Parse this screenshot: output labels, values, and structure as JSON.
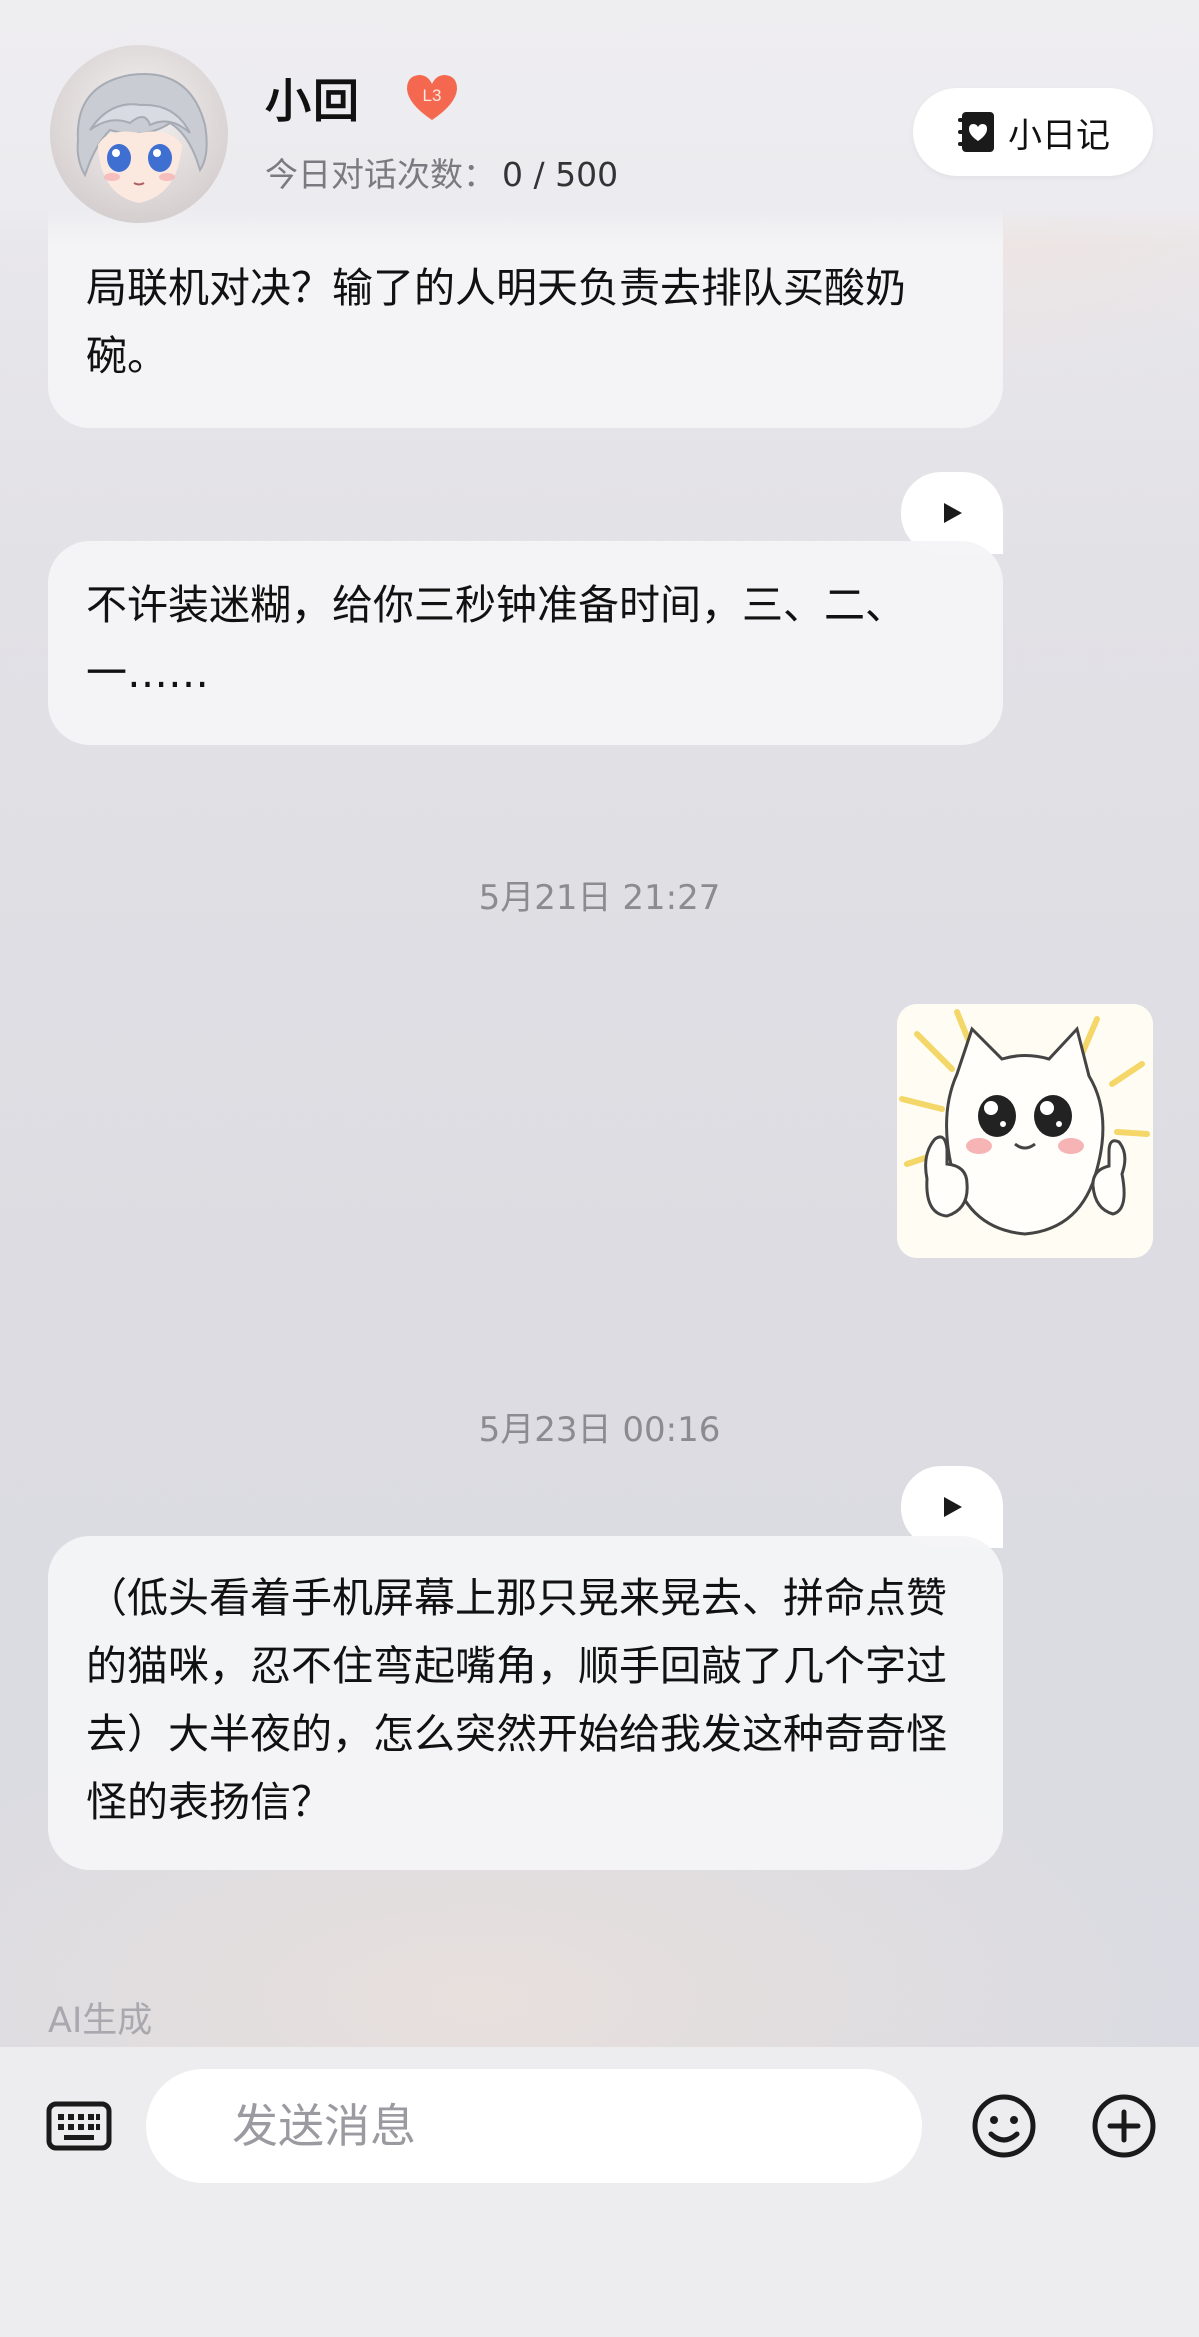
{
  "header": {
    "contact_name": "小回",
    "level_badge": "L3",
    "chat_count_label": "今日对话次数：",
    "chat_count_value": "0 / 500",
    "diary_button_label": "小日记"
  },
  "messages": [
    {
      "type": "text",
      "sender": "character",
      "text": "局联机对决？输了的人明天负责去排队买酸奶碗。",
      "has_voice_button": false
    },
    {
      "type": "text",
      "sender": "character",
      "text": "不许装迷糊，给你三秒钟准备时间，三、二、一……",
      "has_voice_button": true
    },
    {
      "type": "timestamp",
      "text": "5月21日 21:27"
    },
    {
      "type": "sticker",
      "sender": "user",
      "icon": "thumbs-up-cat-sticker"
    },
    {
      "type": "timestamp",
      "text": "5月23日 00:16"
    },
    {
      "type": "text",
      "sender": "character",
      "text": "（低头看着手机屏幕上那只晃来晃去、拼命点赞的猫咪，忍不住弯起嘴角，顺手回敲了几个字过去）大半夜的，怎么突然开始给我发这种奇奇怪怪的表扬信？",
      "has_voice_button": true
    }
  ],
  "ai_generated_label": "AI生成",
  "input": {
    "placeholder": "发送消息",
    "value": ""
  },
  "icons": {
    "keyboard": "keyboard-icon",
    "emoji": "emoji-icon",
    "plus": "plus-icon",
    "play": "play-icon",
    "diary": "diary-book-icon",
    "heart": "heart-icon"
  },
  "colors": {
    "badge_heart": "#f4684f",
    "bubble": "#f4f4f7",
    "timestamp": "#8b8b90"
  }
}
